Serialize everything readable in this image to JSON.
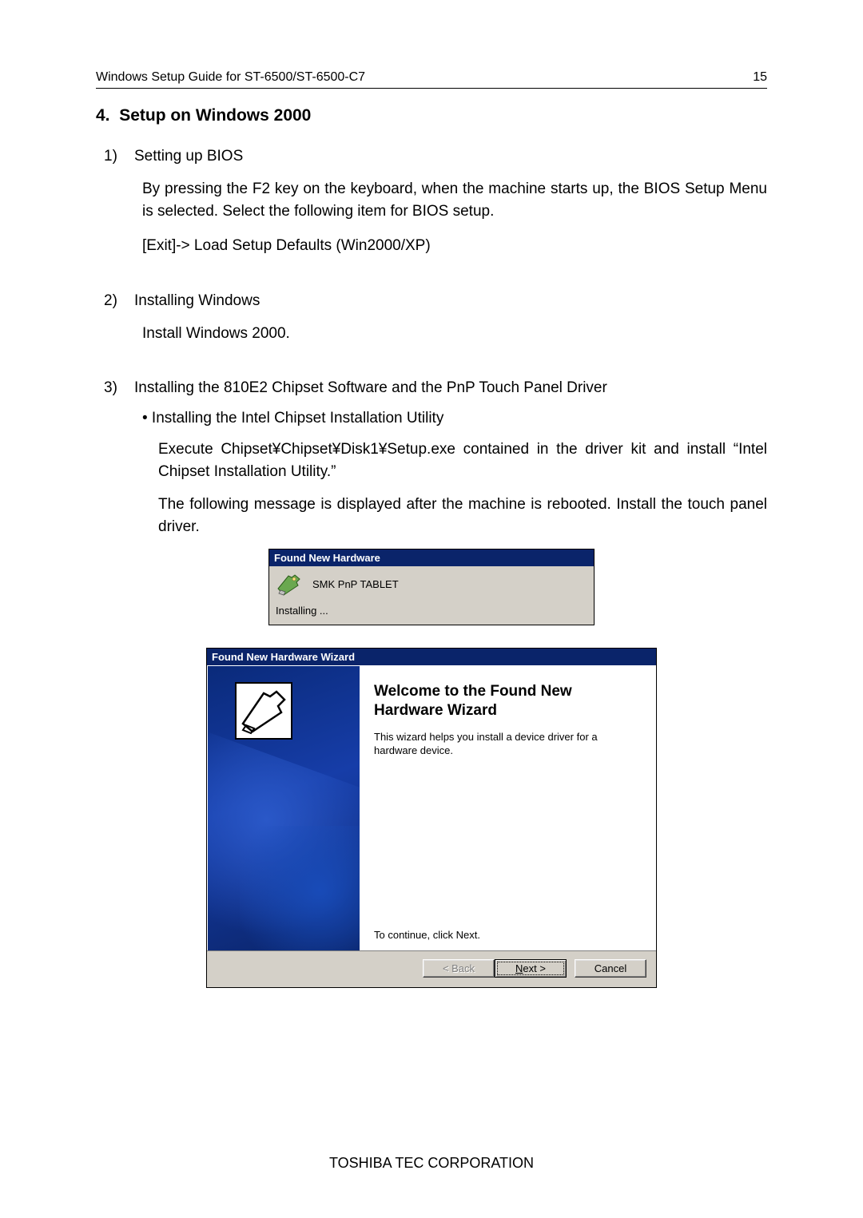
{
  "header": {
    "doc_title": "Windows Setup Guide for ST-6500/ST-6500-C7",
    "page_number": "15"
  },
  "section": {
    "number": "4.",
    "title": "Setup on Windows 2000"
  },
  "items": {
    "i1": {
      "num": "1)",
      "label": "Setting up BIOS"
    },
    "i2": {
      "num": "2)",
      "label": "Installing Windows"
    },
    "i3": {
      "num": "3)",
      "label": "Installing the 810E2 Chipset Software and the PnP Touch Panel Driver"
    }
  },
  "paras": {
    "p1": "By pressing the F2 key on the keyboard, when the machine starts up, the BIOS Setup Menu is selected.  Select the following item for BIOS setup.",
    "p2": "[Exit]-> Load Setup Defaults (Win2000/XP)",
    "p3": "Install Windows 2000.",
    "bullet": "• Installing the Intel Chipset Installation Utility",
    "p4": "Execute Chipset¥Chipset¥Disk1¥Setup.exe contained in the driver kit and install “Intel Chipset Installation Utility.”",
    "p5": "The following message is displayed after the machine is rebooted.  Install the touch panel driver."
  },
  "fnh_small": {
    "title": "Found New Hardware",
    "device": "SMK PnP TABLET",
    "status": "Installing ..."
  },
  "wizard": {
    "title": "Found New Hardware Wizard",
    "heading": "Welcome to the Found New Hardware Wizard",
    "desc": "This wizard helps you install a device driver for a hardware device.",
    "continue": "To continue, click Next.",
    "buttons": {
      "back": "< Back",
      "next": "Next >",
      "cancel": "Cancel"
    }
  },
  "footer": "TOSHIBA TEC CORPORATION"
}
